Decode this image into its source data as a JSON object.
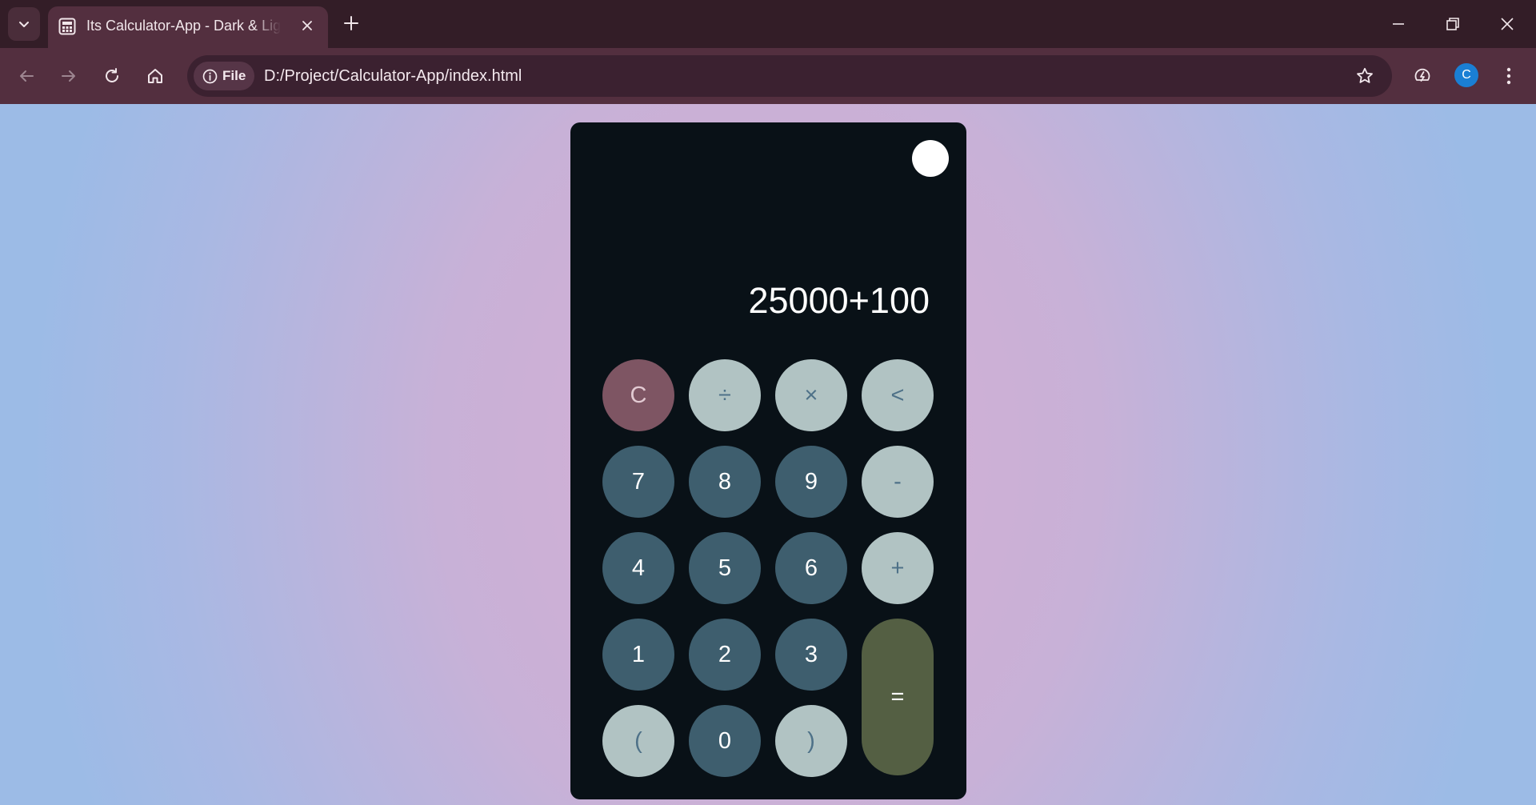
{
  "browser": {
    "tab": {
      "title": "Its Calculator-App - Dark & Light Theme"
    },
    "address_bar": {
      "scheme_chip": "File",
      "url": "D:/Project/Calculator-App/index.html"
    },
    "profile_initial": "C",
    "icons": {
      "tab_search": "chevron-down-icon",
      "favicon": "calculator-icon",
      "tab_close": "close-icon",
      "new_tab": "plus-icon",
      "back": "arrow-left-icon",
      "forward": "arrow-right-icon",
      "reload": "reload-icon",
      "home": "home-icon",
      "site_info": "info-icon",
      "bookmark": "star-icon",
      "performance": "speedometer-icon",
      "menu": "kebab-menu-icon",
      "minimize": "minimize-icon",
      "restore": "restore-icon",
      "close_window": "close-icon"
    }
  },
  "calculator": {
    "display": "25000+100",
    "keys": {
      "clear": "C",
      "divide": "÷",
      "multiply": "×",
      "backspace": "<",
      "seven": "7",
      "eight": "8",
      "nine": "9",
      "minus": "-",
      "four": "4",
      "five": "5",
      "six": "6",
      "plus": "+",
      "one": "1",
      "two": "2",
      "three": "3",
      "equals": "=",
      "open_paren": "(",
      "zero": "0",
      "close_paren": ")"
    }
  },
  "colors": {
    "chrome_frame": "#331d27",
    "chrome_toolbar": "#532f3f",
    "calculator_bg": "#091117",
    "number_key": "#3e5e6e",
    "operator_key": "#b1c3c3",
    "clear_key": "#7e5563",
    "equals_key": "#545f43",
    "theme_toggle": "#ffffff"
  }
}
